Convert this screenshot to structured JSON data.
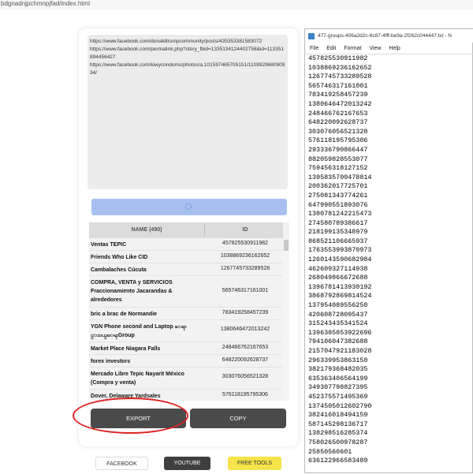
{
  "browser": {
    "url": "bdgnadnjpchmnpjfad/index.html"
  },
  "panel": {
    "textarea_lines": [
      "https://www.facebook.com/donaldtrumpcommunity/posts/435353381583072",
      "https://www.facebook.com/permalink.php?story_fbid=1335134124402758&id=113351894456427",
      "https://www.facebook.com/kiwycondoms/photos/a.101597465705151/110992968090934/"
    ],
    "table": {
      "headers": {
        "name": "NAME (490)",
        "id": "ID"
      },
      "rows": [
        {
          "name": "Ventas TEPIC",
          "id": "457825530911982"
        },
        {
          "name": "Friends Who Like CID",
          "id": "1038869236162652"
        },
        {
          "name": "Cambalaches Cúcuta",
          "id": "1267745733289528"
        },
        {
          "name": "COMPRA, VENTA y SERVICIOS Fraccionamiento Jacarandas & alrededores",
          "id": "565746317161001"
        },
        {
          "name": "bric a brac de Normandie",
          "id": "783419258457239"
        },
        {
          "name": "YGN Phone second and Laptop ေရာင္း၀ယ္ေရးGroup",
          "id": "1380646472013242"
        },
        {
          "name": "Market Place Niagara Falls",
          "id": "248466762167653"
        },
        {
          "name": "forex investors",
          "id": "648220092628737"
        },
        {
          "name": "Mercado Libre Tepic Nayarit México (Compra y venta)",
          "id": "303076056521328"
        },
        {
          "name": "Dover, Delaware Yardsales",
          "id": "576118195795306"
        }
      ]
    },
    "buttons": {
      "export": "EXPORT",
      "copy": "COPY"
    },
    "footer": {
      "facebook": "FACEBOOK",
      "youtube": "YOUTUBE",
      "free_tools": "FREE TOOLS"
    }
  },
  "notepad": {
    "title": "477-groups-406a2d2c-6c87-4fff-be9a-2f262c044447.txt - N",
    "menu": [
      "File",
      "Edit",
      "Format",
      "View",
      "Help"
    ],
    "lines": [
      "457825530911982",
      "1038869236162652",
      "1267745733289528",
      "565746317161001",
      "783419258457239",
      "1380646472013242",
      "248466762167653",
      "648220092628737",
      "303076056521328",
      "576118195795306",
      "293336790866447",
      "882059828553077",
      "759456318127152",
      "1395835700478814",
      "200362017725701",
      "275081343774261",
      "647990551893076",
      "1380781242215473",
      "274580789386617",
      "218199135348979",
      "868521106665937",
      "1763553993870973",
      "1260143590682984",
      "462609327114938",
      "268049866672688",
      "1396781413930192",
      "386879286981452​4",
      "137954089556250",
      "420608728095437",
      "315243435341524",
      "1396385853922696",
      "794106047382688",
      "2157047921183028",
      "296339953863150",
      "382179368482035",
      "635363406564199",
      "349307798827395",
      "452375571495369",
      "1374505012602790",
      "382416018494159",
      "587145298136717",
      "138298516285374",
      "758026500978287",
      "25850560601",
      "636122966583489"
    ]
  }
}
